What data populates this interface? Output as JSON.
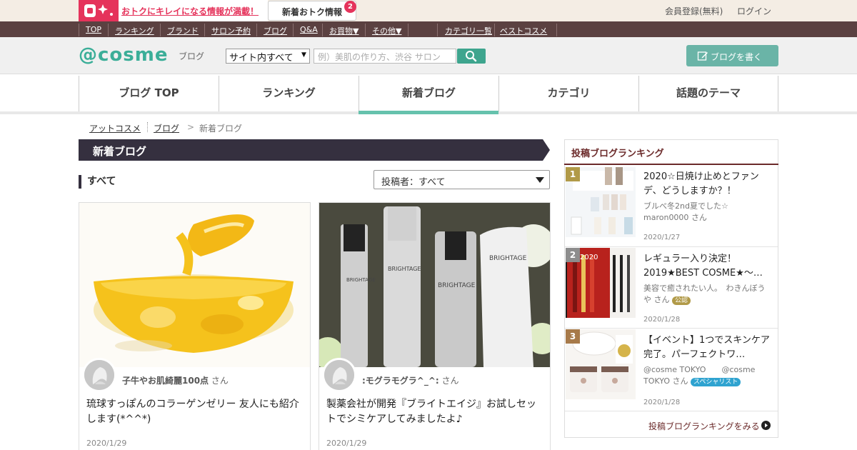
{
  "topbar": {
    "promo_text": "おトクにキレイになる情報が満載！",
    "news_label": "新着おトク情報",
    "news_count": "2",
    "register": "会員登録(無料)",
    "login": "ログイン"
  },
  "darknav": {
    "items": [
      "TOP",
      "ランキング",
      "ブランド",
      "サロン予約",
      "ブログ",
      "Q&A",
      "お買物▼",
      "その他▼"
    ],
    "right_items": [
      "カテゴリ一覧",
      "ベストコスメ"
    ]
  },
  "header": {
    "logo": "@cosme",
    "logo_sub": "ブログ",
    "search_select": "サイト内すべて",
    "search_placeholder": "例）美肌の作り方、渋谷 サロン",
    "write_button": "ブログを書く"
  },
  "tabs": [
    "ブログ TOP",
    "ランキング",
    "新着ブログ",
    "カテゴリ",
    "話題のテーマ"
  ],
  "breadcrumb": [
    "アットコスメ",
    "ブログ",
    ">",
    "新着ブログ"
  ],
  "section": {
    "title": "新着ブログ",
    "filter_label": "すべて",
    "author_select": "投稿者：すべて"
  },
  "posts": [
    {
      "author": "子牛やお肌綺麗100点",
      "author_suffix": "さん",
      "title": "琉球すっぽんのコラーゲンゼリー 友人にも紹介します(*^^*)",
      "date": "2020/1/29"
    },
    {
      "author": ":モグラモグラ^_^:",
      "author_suffix": "さん",
      "title": "製薬会社が開発『ブライトエイジ』お試しセットでシミケアしてみましたよ♪",
      "date": "2020/1/29"
    }
  ],
  "ranking": {
    "title": "投稿ブログランキング",
    "items": [
      {
        "num": "1",
        "title": "2020☆日焼け止めとファンデ、どうしますか？！",
        "author": "ブルべ冬2nd夏でした☆　maron0000",
        "suffix": "さん",
        "badge": "",
        "date": "2020/1/27"
      },
      {
        "num": "2",
        "title": "レギュラー入り決定！2019★BEST COSME★～…",
        "author": "美容で癒されたい人。　わきんぼうや",
        "suffix": "さん",
        "badge": "公認",
        "date": "2020/1/28"
      },
      {
        "num": "3",
        "title": "【イベント】1つでスキンケア完了。パーフェクトワ…",
        "author": "@cosme TOKYO　　@cosme TOKYO",
        "suffix": "さん",
        "badge": "スペシャリスト",
        "date": "2020/1/28"
      }
    ],
    "more": "投稿ブログランキングをみる"
  },
  "colors": {
    "brand": "#3bae98",
    "accent_pink": "#e5335b",
    "dark_nav": "#5b4141",
    "section_bar": "#35303f",
    "ranking_title": "#6b2a2a"
  }
}
